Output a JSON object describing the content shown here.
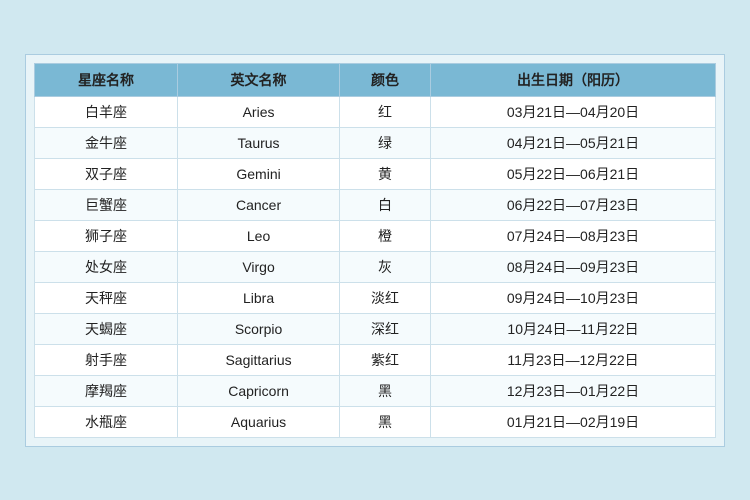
{
  "table": {
    "headers": [
      "星座名称",
      "英文名称",
      "颜色",
      "出生日期（阳历）"
    ],
    "rows": [
      {
        "zh": "白羊座",
        "en": "Aries",
        "color": "红",
        "dates": "03月21日—04月20日"
      },
      {
        "zh": "金牛座",
        "en": "Taurus",
        "color": "绿",
        "dates": "04月21日—05月21日"
      },
      {
        "zh": "双子座",
        "en": "Gemini",
        "color": "黄",
        "dates": "05月22日—06月21日"
      },
      {
        "zh": "巨蟹座",
        "en": "Cancer",
        "color": "白",
        "dates": "06月22日—07月23日"
      },
      {
        "zh": "狮子座",
        "en": "Leo",
        "color": "橙",
        "dates": "07月24日—08月23日"
      },
      {
        "zh": "处女座",
        "en": "Virgo",
        "color": "灰",
        "dates": "08月24日—09月23日"
      },
      {
        "zh": "天秤座",
        "en": "Libra",
        "color": "淡红",
        "dates": "09月24日—10月23日"
      },
      {
        "zh": "天蝎座",
        "en": "Scorpio",
        "color": "深红",
        "dates": "10月24日—11月22日"
      },
      {
        "zh": "射手座",
        "en": "Sagittarius",
        "color": "紫红",
        "dates": "11月23日—12月22日"
      },
      {
        "zh": "摩羯座",
        "en": "Capricorn",
        "color": "黑",
        "dates": "12月23日—01月22日"
      },
      {
        "zh": "水瓶座",
        "en": "Aquarius",
        "color": "黑",
        "dates": "01月21日—02月19日"
      }
    ]
  }
}
